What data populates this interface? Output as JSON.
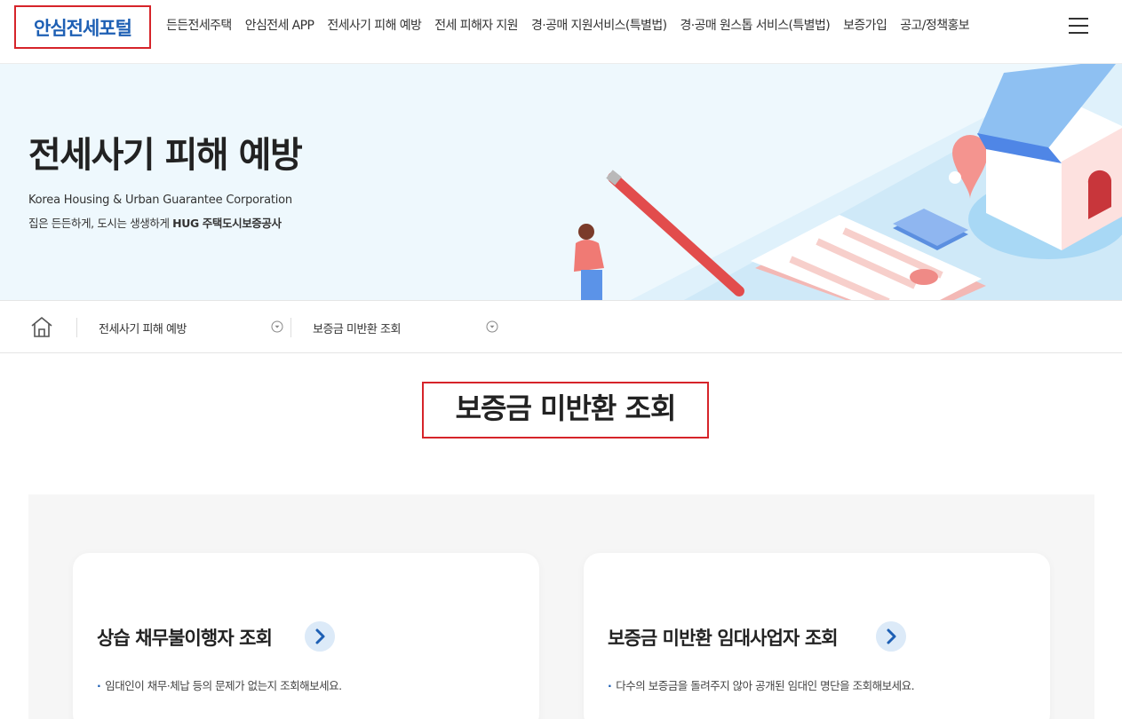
{
  "header": {
    "logo": "안심전세포털",
    "nav": [
      "든든전세주택",
      "안심전세 APP",
      "전세사기 피해 예방",
      "전세 피해자 지원",
      "경·공매 지원서비스(특별법)",
      "경·공매 원스톱 서비스(특별법)",
      "보증가입",
      "공고/정책홍보"
    ],
    "menu_icon": "hamburger-icon"
  },
  "banner": {
    "title": "전세사기 피해 예방",
    "subtitle_en": "Korea Housing & Urban Guarantee Corporation",
    "subtitle_kr_prefix": "집은 든든하게, 도시는 생생하게 ",
    "subtitle_kr_bold": "HUG 주택도시보증공사"
  },
  "breadcrumb": {
    "home_icon": "home-icon",
    "level1": "전세사기 피해 예방",
    "level2": "보증금 미반환 조회",
    "dropdown_icon": "chevron-down-circle-icon"
  },
  "page_title": "보증금 미반환 조회",
  "cards": [
    {
      "title": "상습 채무불이행자 조회",
      "description": "임대인이 채무·체납 등의 문제가 없는지 조회해보세요.",
      "icon": "chevron-right-icon"
    },
    {
      "title": "보증금 미반환 임대사업자 조회",
      "description": "다수의 보증금을 돌려주지 않아 공개된 임대인 명단을 조회해보세요.",
      "icon": "chevron-right-icon"
    }
  ],
  "colors": {
    "brand_blue": "#1d5fb4",
    "highlight_red": "#d6242a",
    "banner_bg": "#eef8fd",
    "panel_bg": "#f6f6f6"
  }
}
